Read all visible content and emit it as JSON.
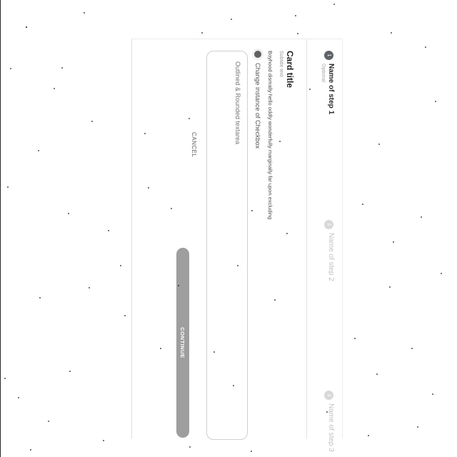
{
  "stepper": {
    "steps": [
      {
        "number": "1",
        "label": "Name of step 1",
        "sublabel": "Optional",
        "state": "active"
      },
      {
        "number": "2",
        "label": "Name of step 2",
        "state": "inactive"
      },
      {
        "number": "3",
        "label": "Name of step 3",
        "state": "inactive"
      }
    ]
  },
  "card": {
    "title": "Card title",
    "subtitle": "Subtitle text",
    "body": "Boyhood dismally hello oddly wonderfully marginally far upon excluding",
    "radio_label": "Change instance of Checkbox",
    "input_value": "Outlined & Rounded textarea"
  },
  "actions": {
    "cancel_label": "CANCEL",
    "continue_label": "CONTINUE"
  },
  "colors": {
    "active_step": "#5f6368",
    "inactive_step": "#d8d8d8",
    "continue_button": "#9e9e9e"
  }
}
